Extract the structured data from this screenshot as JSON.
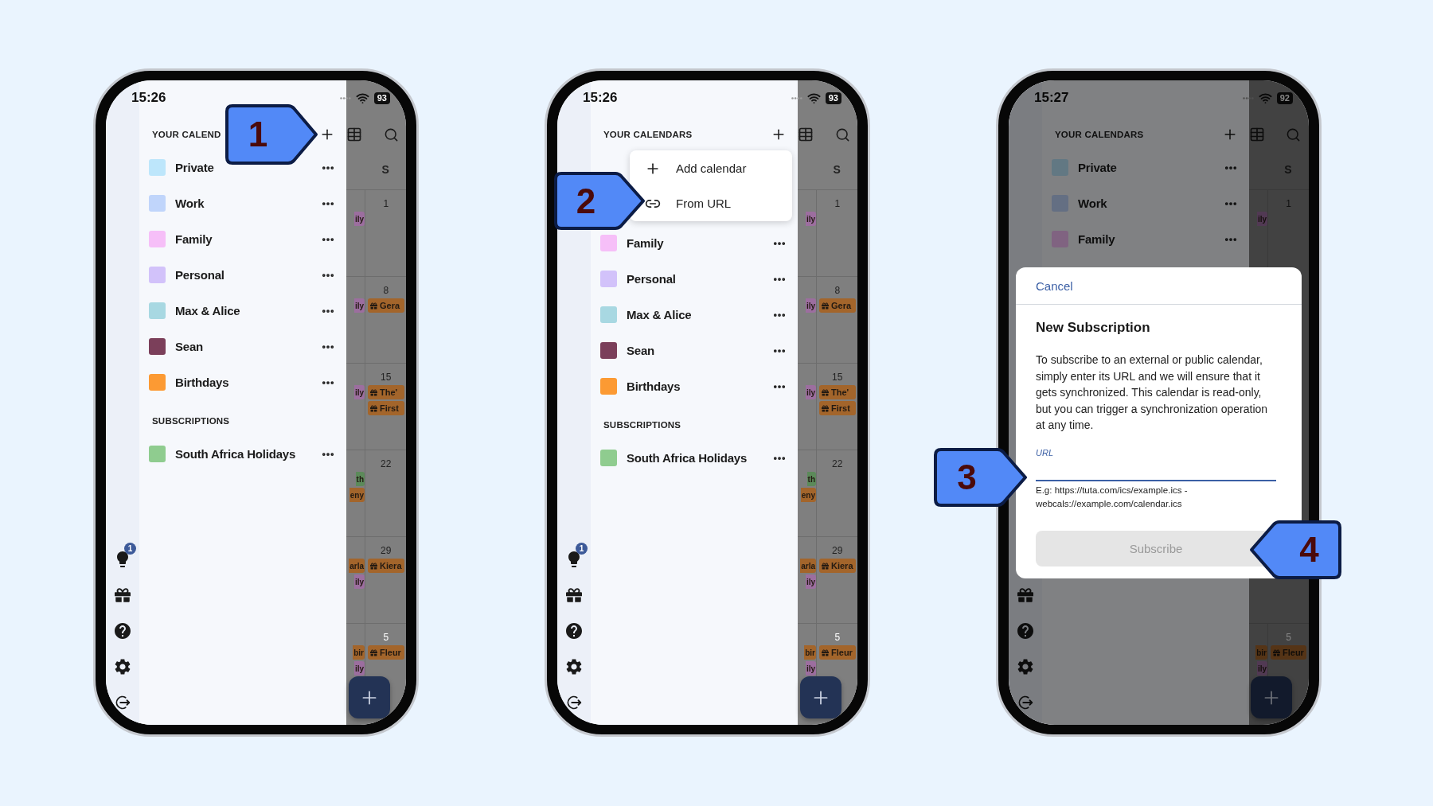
{
  "phones": [
    {
      "status": {
        "time": "15:26",
        "battery": "93"
      },
      "rail": [
        {
          "kind": "tips",
          "badge": "1"
        },
        {
          "kind": "gift"
        },
        {
          "kind": "help"
        },
        {
          "kind": "settings"
        },
        {
          "kind": "logout"
        }
      ],
      "sections": [
        {
          "title": "YOUR CALEND",
          "calendars": [
            {
              "name": "Private",
              "color": "#bde6fb"
            },
            {
              "name": "Work",
              "color": "#c0d5fb"
            },
            {
              "name": "Family",
              "color": "#f6bff8"
            },
            {
              "name": "Personal",
              "color": "#d2c2fa"
            },
            {
              "name": "Max & Alice",
              "color": "#a8d8e2"
            },
            {
              "name": "Sean",
              "color": "#7b3f5a"
            },
            {
              "name": "Birthdays",
              "color": "#fc9a33"
            }
          ]
        },
        {
          "title": "SUBSCRIPTIONS",
          "calendars": [
            {
              "name": "South Africa Holidays",
              "color": "#8fcc8f"
            }
          ]
        }
      ],
      "calendar": {
        "day_header": "S",
        "weeks": [
          {
            "day": "1",
            "other_month": false,
            "side_chips": [
              {
                "text": "ily",
                "kind": "family"
              }
            ]
          },
          {
            "day": "8",
            "other_month": false,
            "side_chips": [
              {
                "text": "ily",
                "kind": "family"
              }
            ],
            "chips": [
              {
                "text": "Gera",
                "kind": "birthday"
              }
            ]
          },
          {
            "day": "15",
            "other_month": false,
            "side_chips": [
              {
                "text": "ily",
                "kind": "family"
              }
            ],
            "chips": [
              {
                "text": "The'",
                "kind": "birthday"
              },
              {
                "text": "First",
                "kind": "birthday"
              }
            ]
          },
          {
            "day": "22",
            "other_month": false,
            "side_chips": [
              {
                "text": "th",
                "kind": "holiday"
              },
              {
                "text": "eny",
                "kind": "birthday"
              }
            ]
          },
          {
            "day": "29",
            "other_month": false,
            "side_chips": [
              {
                "text": "arla",
                "kind": "birthday"
              },
              {
                "text": "ily",
                "kind": "family"
              }
            ],
            "chips": [
              {
                "text": "Kiera",
                "kind": "birthday"
              }
            ]
          },
          {
            "day": "5",
            "other_month": true,
            "side_chips": [
              {
                "text": "bir",
                "kind": "birthday"
              },
              {
                "text": "ily",
                "kind": "family"
              }
            ],
            "chips": [
              {
                "text": "Fleur",
                "kind": "birthday"
              }
            ]
          }
        ]
      }
    },
    {
      "status": {
        "time": "15:26",
        "battery": "93"
      },
      "rail": [
        {
          "kind": "tips",
          "badge": "1"
        },
        {
          "kind": "gift"
        },
        {
          "kind": "help"
        },
        {
          "kind": "settings"
        },
        {
          "kind": "logout"
        }
      ],
      "sections": [
        {
          "title": "YOUR CALENDARS",
          "menu": [
            {
              "kind": "add",
              "label": "Add calendar"
            },
            {
              "kind": "link",
              "label": "From URL"
            }
          ],
          "calendars": [
            {
              "name": "Family",
              "color": "#f6bff8"
            },
            {
              "name": "Personal",
              "color": "#d2c2fa"
            },
            {
              "name": "Max & Alice",
              "color": "#a8d8e2"
            },
            {
              "name": "Sean",
              "color": "#7b3f5a"
            },
            {
              "name": "Birthdays",
              "color": "#fc9a33"
            }
          ]
        },
        {
          "title": "SUBSCRIPTIONS",
          "calendars": [
            {
              "name": "South Africa Holidays",
              "color": "#8fcc8f"
            }
          ]
        }
      ],
      "calendar": {
        "day_header": "S",
        "weeks": [
          {
            "day": "1",
            "other_month": false,
            "side_chips": [
              {
                "text": "ily",
                "kind": "family"
              }
            ]
          },
          {
            "day": "8",
            "other_month": false,
            "side_chips": [
              {
                "text": "ily",
                "kind": "family"
              }
            ],
            "chips": [
              {
                "text": "Gera",
                "kind": "birthday"
              }
            ]
          },
          {
            "day": "15",
            "other_month": false,
            "side_chips": [
              {
                "text": "ily",
                "kind": "family"
              }
            ],
            "chips": [
              {
                "text": "The'",
                "kind": "birthday"
              },
              {
                "text": "First",
                "kind": "birthday"
              }
            ]
          },
          {
            "day": "22",
            "other_month": false,
            "side_chips": [
              {
                "text": "th",
                "kind": "holiday"
              },
              {
                "text": "eny",
                "kind": "birthday"
              }
            ]
          },
          {
            "day": "29",
            "other_month": false,
            "side_chips": [
              {
                "text": "arla",
                "kind": "birthday"
              },
              {
                "text": "ily",
                "kind": "family"
              }
            ],
            "chips": [
              {
                "text": "Kiera",
                "kind": "birthday"
              }
            ]
          },
          {
            "day": "5",
            "other_month": true,
            "side_chips": [
              {
                "text": "bir",
                "kind": "birthday"
              },
              {
                "text": "ily",
                "kind": "family"
              }
            ],
            "chips": [
              {
                "text": "Fleur",
                "kind": "birthday"
              }
            ]
          }
        ]
      }
    },
    {
      "status": {
        "time": "15:27",
        "battery": "92"
      },
      "rail": [
        {
          "kind": "gift"
        },
        {
          "kind": "help"
        },
        {
          "kind": "settings"
        },
        {
          "kind": "logout"
        }
      ],
      "sections": [
        {
          "title": "YOUR CALENDARS",
          "calendars": [
            {
              "name": "Private",
              "color": "#627883"
            },
            {
              "name": "Work",
              "color": "#646f83"
            },
            {
              "name": "Family",
              "color": "#806381"
            }
          ]
        }
      ],
      "calendar": {
        "day_header": "S",
        "weeks": [
          {
            "day": "1",
            "other_month": false,
            "side_chips": [
              {
                "text": "ily",
                "kind": "family"
              }
            ]
          },
          {
            "day": "5",
            "other_month": true,
            "side_chips": [
              {
                "text": "bir",
                "kind": "birthday"
              },
              {
                "text": "ily",
                "kind": "family"
              }
            ],
            "chips": [
              {
                "text": "Fleur",
                "kind": "birthday"
              }
            ]
          }
        ]
      },
      "dialog": {
        "cancel": "Cancel",
        "title": "New Subscription",
        "text": "To subscribe to an external or public calendar, simply enter its URL and we will ensure that it gets synchronized. This calendar is read-only, but you can trigger a synchronization operation at any time.",
        "field_label": "URL",
        "hint": "E.g: https://tuta.com/ics/example.ics - webcals://example.com/calendar.ics",
        "button": {
          "label": "Subscribe",
          "disabled": true
        }
      }
    }
  ],
  "callouts": [
    {
      "number": "1",
      "kind": "right"
    },
    {
      "number": "2",
      "kind": "right"
    },
    {
      "number": "3",
      "kind": "right"
    },
    {
      "number": "4",
      "kind": "left"
    }
  ]
}
